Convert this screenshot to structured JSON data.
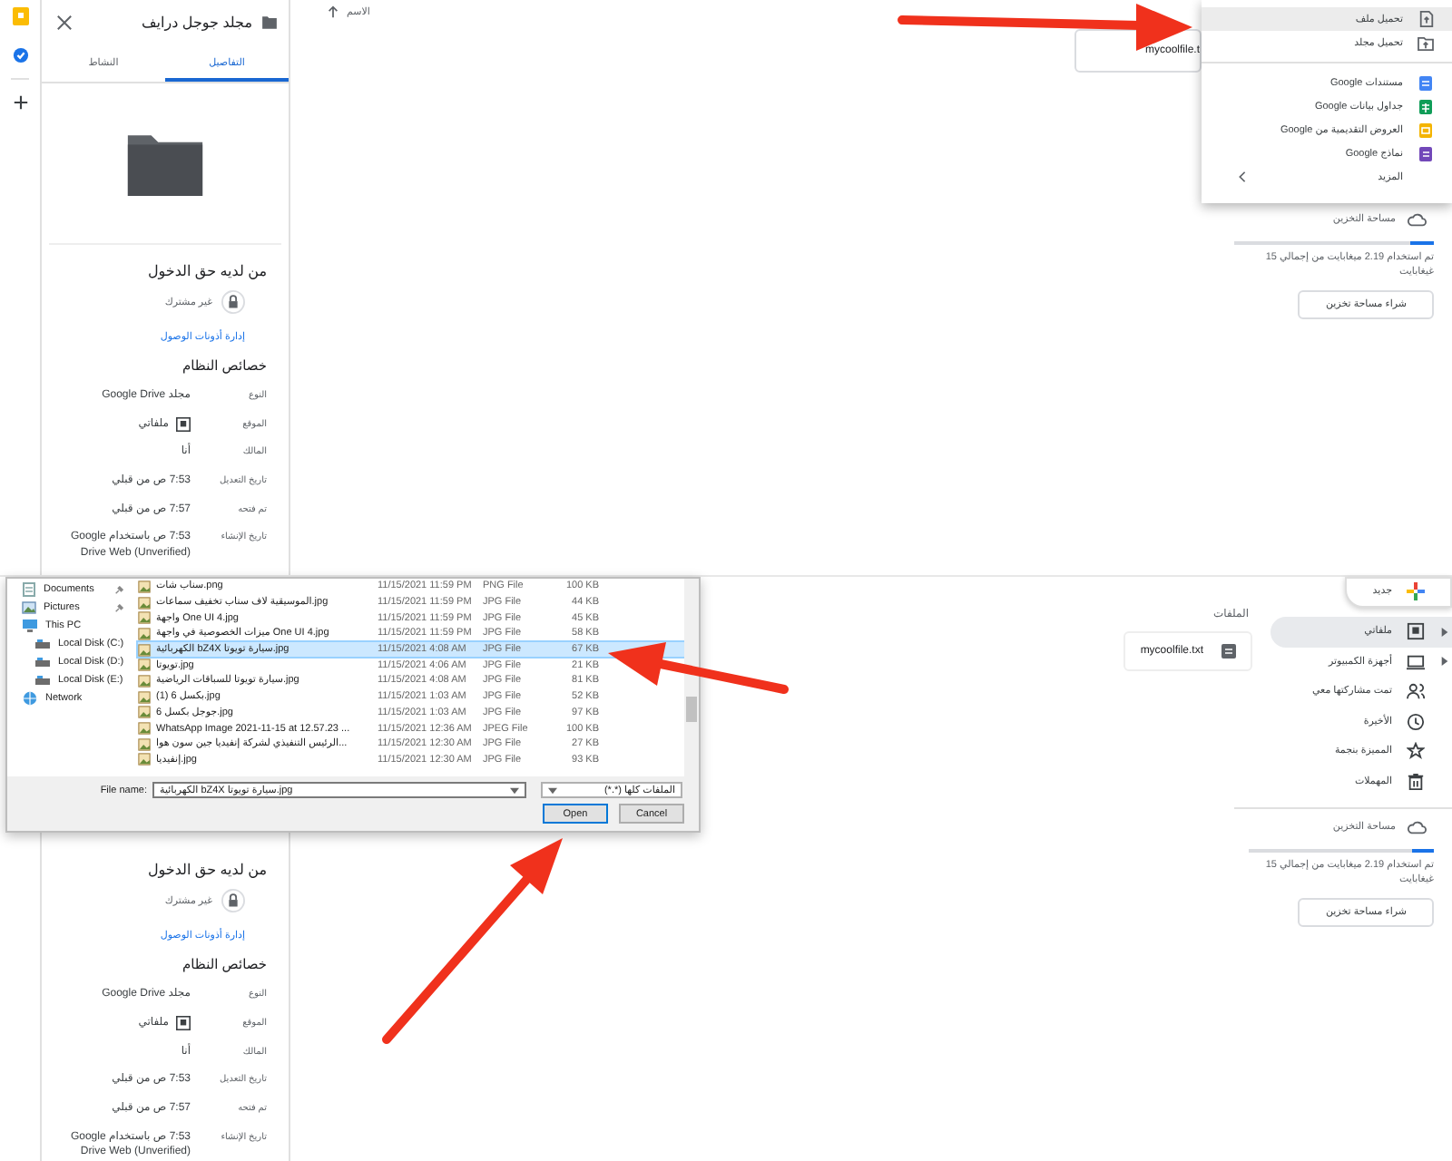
{
  "top_screen": {
    "rail": [
      {
        "kind": "note"
      },
      {
        "kind": "tasks"
      },
      {
        "kind": "add"
      }
    ],
    "details_panel": {
      "title": "مجلد جوجل درايف",
      "tabs": [
        {
          "label": "التفاصيل",
          "selected": true
        },
        {
          "label": "النشاط",
          "selected": false
        }
      ],
      "access_heading": "من لديه حق الدخول",
      "sharing_status": "غير مشترك",
      "manage_link": "إدارة أذونات الوصول",
      "properties_heading": "خصائص النظام",
      "properties": [
        {
          "label": "النوع",
          "value": "مجلد Google Drive",
          "kind": "text"
        },
        {
          "label": "الموقع",
          "value": "ملفاتي",
          "kind": "location"
        },
        {
          "label": "المالك",
          "value": "أنا",
          "kind": "text"
        },
        {
          "label": "تاريخ التعديل",
          "value": "7:53 ص من قبلي",
          "kind": "text"
        },
        {
          "label": "تم فتحه",
          "value": "7:57 ص من قبلي",
          "kind": "text"
        },
        {
          "label": "تاريخ الإنشاء",
          "value": "7:53 ص باستخدام Google Drive Web (Unverified)",
          "kind": "text"
        }
      ]
    },
    "list_header": "الاسم",
    "file_card": "mycoolfile.t",
    "new_menu": {
      "sections": [
        {
          "items": [
            {
              "label": "تحميل ملف",
              "kind": "upload_file",
              "highlighted": true
            },
            {
              "label": "تحميل مجلد",
              "kind": "upload_folder",
              "highlighted": false
            }
          ]
        },
        {
          "items": [
            {
              "label": "مستندات Google",
              "kind": "docs",
              "highlighted": false
            },
            {
              "label": "جداول بيانات Google",
              "kind": "sheets",
              "highlighted": false
            },
            {
              "label": "العروض التقديمية من Google",
              "kind": "slides",
              "highlighted": false
            },
            {
              "label": "نماذج Google",
              "kind": "forms",
              "highlighted": false
            },
            {
              "label": "المزيد",
              "kind": "more",
              "highlighted": false
            }
          ]
        }
      ]
    },
    "storage": {
      "label": "مساحة التخزين",
      "level": 0.12,
      "usage": "تم استخدام 2.19 ميغابايت من إجمالي 15 غيغابايت",
      "button": "شراء مساحة تخزين"
    }
  },
  "bottom_screen": {
    "details_panel": {
      "access_heading": "من لديه حق الدخول",
      "sharing_status": "غير مشترك",
      "manage_link": "إدارة أذونات الوصول",
      "properties_heading": "خصائص النظام",
      "properties": [
        {
          "label": "النوع",
          "value": "مجلد Google Drive",
          "kind": "text"
        },
        {
          "label": "الموقع",
          "value": "ملفاتي",
          "kind": "location"
        },
        {
          "label": "المالك",
          "value": "أنا",
          "kind": "text"
        },
        {
          "label": "تاريخ التعديل",
          "value": "7:53 ص من قبلي",
          "kind": "text"
        },
        {
          "label": "تم فتحه",
          "value": "7:57 ص من قبلي",
          "kind": "text"
        },
        {
          "label": "تاريخ الإنشاء",
          "value": "7:53 ص باستخدام Google Drive Web (Unverified)",
          "kind": "text"
        }
      ]
    },
    "section_label": "الملفات",
    "file": "mycoolfile.txt",
    "new_button": "جديد",
    "nav": [
      {
        "label": "ملفاتي",
        "kind": "drive",
        "selected": true,
        "expandable": true
      },
      {
        "label": "أجهزة الكمبيوتر",
        "kind": "computers",
        "selected": false,
        "expandable": true
      },
      {
        "label": "تمت مشاركتها معي",
        "kind": "shared",
        "selected": false,
        "expandable": false
      },
      {
        "label": "الأخيرة",
        "kind": "recent",
        "selected": false,
        "expandable": false
      },
      {
        "label": "المميزة بنجمة",
        "kind": "starred",
        "selected": false,
        "expandable": false
      },
      {
        "label": "المهملات",
        "kind": "trash",
        "selected": false,
        "expandable": false
      }
    ],
    "storage": {
      "label": "مساحة التخزين",
      "level": 0.12,
      "usage": "تم استخدام 2.19 ميغابايت من إجمالي 15 غيغابايت",
      "button": "شراء مساحة تخزين"
    }
  },
  "file_dialog": {
    "nav": [
      {
        "label": "Documents",
        "kind": "documents",
        "pinned": true
      },
      {
        "label": "Pictures",
        "kind": "pictures",
        "pinned": true
      },
      {
        "label": "This PC",
        "kind": "pc",
        "pinned": false,
        "children": [
          {
            "label": "Local Disk (C:)",
            "kind": "disk",
            "pinned": false
          },
          {
            "label": "Local Disk (D:)",
            "kind": "disk",
            "pinned": false
          },
          {
            "label": "Local Disk (E:)",
            "kind": "disk",
            "pinned": false
          }
        ]
      },
      {
        "label": "Network",
        "kind": "network",
        "pinned": false
      }
    ],
    "files": [
      {
        "name": "سناب شات.png",
        "date": "11/15/2021 11:59 PM",
        "type": "PNG File",
        "size": "100 KB",
        "selected": false
      },
      {
        "name": "الموسيقية لاف سناب تخفيف سماعات.jpg",
        "date": "11/15/2021 11:59 PM",
        "type": "JPG File",
        "size": "44 KB",
        "selected": false
      },
      {
        "name": "واجهة One UI 4.jpg",
        "date": "11/15/2021 11:59 PM",
        "type": "JPG File",
        "size": "45 KB",
        "selected": false
      },
      {
        "name": "ميزات الخصوصية في واجهة One UI 4.jpg",
        "date": "11/15/2021 11:59 PM",
        "type": "JPG File",
        "size": "58 KB",
        "selected": false
      },
      {
        "name": "الكهربائية bZ4X سيارة تويوتا.jpg",
        "date": "11/15/2021 4:08 AM",
        "type": "JPG File",
        "size": "67 KB",
        "selected": true
      },
      {
        "name": "تويوتا.jpg",
        "date": "11/15/2021 4:06 AM",
        "type": "JPG File",
        "size": "21 KB",
        "selected": false
      },
      {
        "name": "سيارة تويوتا للسباقات الرياضية.jpg",
        "date": "11/15/2021 4:08 AM",
        "type": "JPG File",
        "size": "81 KB",
        "selected": false
      },
      {
        "name": "بكسل 6 (1).jpg",
        "date": "11/15/2021 1:03 AM",
        "type": "JPG File",
        "size": "52 KB",
        "selected": false
      },
      {
        "name": "جوجل بكسل 6.jpg",
        "date": "11/15/2021 1:03 AM",
        "type": "JPG File",
        "size": "97 KB",
        "selected": false
      },
      {
        "name": "WhatsApp Image 2021-11-15 at 12.57.23 ...",
        "date": "11/15/2021 12:36 AM",
        "type": "JPEG File",
        "size": "100 KB",
        "selected": false
      },
      {
        "name": "الرئيس التنفيذي لشركة إنفيديا جين سون هوا...",
        "date": "11/15/2021 12:30 AM",
        "type": "JPG File",
        "size": "27 KB",
        "selected": false
      },
      {
        "name": "إنفيديا.jpg",
        "date": "11/15/2021 12:30 AM",
        "type": "JPG File",
        "size": "93 KB",
        "selected": false
      }
    ],
    "file_name_label": "File name:",
    "file_name": "الكهربائية bZ4X سيارة تويوتا.jpg",
    "file_type": "الملفات كلها (*.*)",
    "buttons": [
      {
        "label": "Cancel",
        "kind": "normal"
      },
      {
        "label": "Open",
        "kind": "primary"
      }
    ]
  }
}
